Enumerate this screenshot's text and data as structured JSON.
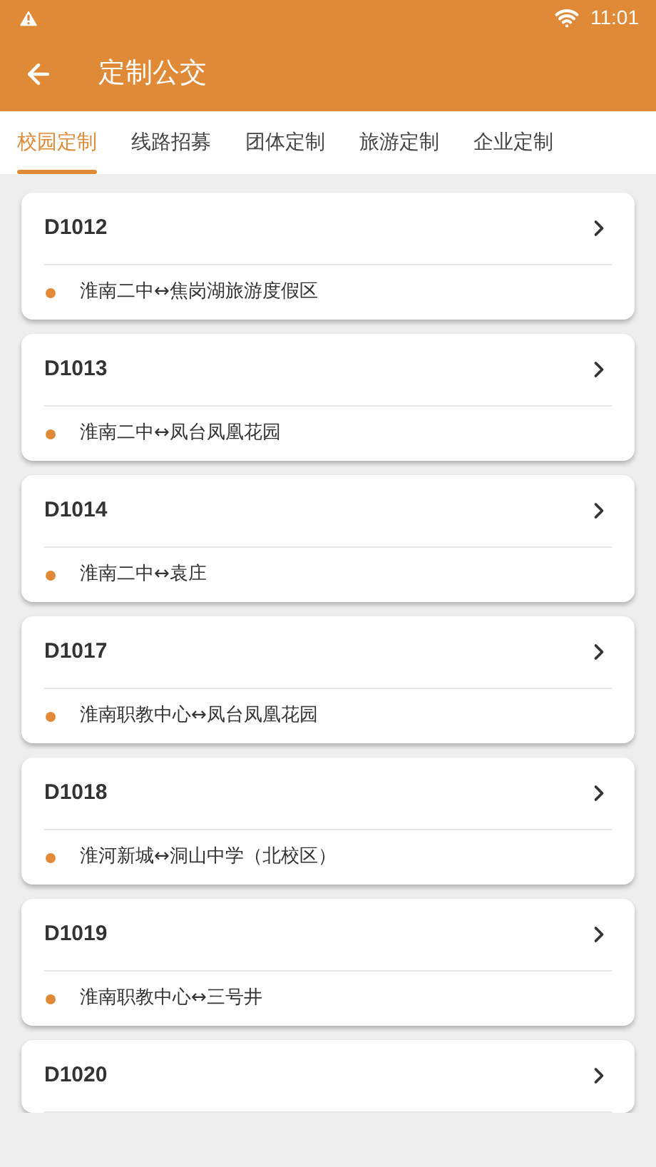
{
  "status_bar": {
    "time": "11:01"
  },
  "app_bar": {
    "title": "定制公交"
  },
  "tabs": [
    {
      "label": "校园定制",
      "selected": true
    },
    {
      "label": "线路招募",
      "selected": false
    },
    {
      "label": "团体定制",
      "selected": false
    },
    {
      "label": "旅游定制",
      "selected": false
    },
    {
      "label": "企业定制",
      "selected": false
    }
  ],
  "routes": [
    {
      "code": "D1012",
      "route": "淮南二中↔焦岗湖旅游度假区"
    },
    {
      "code": "D1013",
      "route": "淮南二中↔凤台凤凰花园"
    },
    {
      "code": "D1014",
      "route": "淮南二中↔袁庄"
    },
    {
      "code": "D1017",
      "route": "淮南职教中心↔凤台凤凰花园"
    },
    {
      "code": "D1018",
      "route": "淮河新城↔洞山中学（北校区）"
    },
    {
      "code": "D1019",
      "route": "淮南职教中心↔三号井"
    },
    {
      "code": "D1020"
    }
  ]
}
